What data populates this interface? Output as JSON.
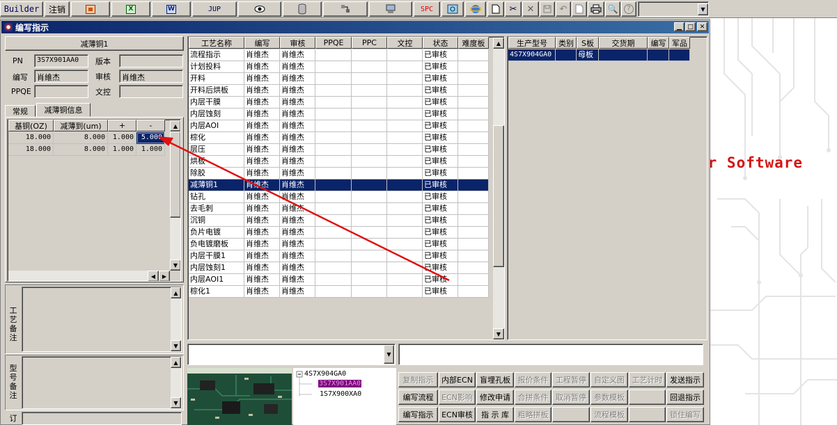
{
  "toolbar": {
    "builder_label": "Builder",
    "logout_label": "注销",
    "jup_label": "JUP",
    "spc_label": "SPC"
  },
  "window": {
    "title": "编写指示"
  },
  "left": {
    "header": "减薄铜1",
    "pn_label": "PN",
    "pn_value": "3S7X901AA0",
    "version_label": "版本",
    "version_value": "",
    "writer_label": "编写",
    "writer_value": "肖維杰",
    "reviewer_label": "审核",
    "reviewer_value": "肖维杰",
    "ppqe_label": "PPQE",
    "ppqe_value": "",
    "doc_control_label": "文控",
    "doc_control_value": "",
    "tabs": [
      "常规",
      "减薄铜信息"
    ],
    "active_tab": 1,
    "thin_grid": {
      "headers": [
        "基铜(OZ)",
        "减薄到(um)",
        "+",
        "-"
      ],
      "rows": [
        [
          "18.000",
          "8.000",
          "1.000",
          "5.000"
        ],
        [
          "18.000",
          "8.000",
          "1.000",
          "1.000"
        ]
      ]
    },
    "process_note_label": "工艺备注",
    "model_note_label": "型号备注",
    "order_label": "订"
  },
  "process_grid": {
    "headers": [
      "工艺名称",
      "编写",
      "审核",
      "PPQE",
      "PPC",
      "文控",
      "状态",
      "难度板"
    ],
    "selected_index": 11,
    "rows": [
      [
        "流程指示",
        "肖维杰",
        "肖维杰",
        "",
        "",
        "",
        "已审核",
        ""
      ],
      [
        "计划投料",
        "肖维杰",
        "肖维杰",
        "",
        "",
        "",
        "已审核",
        ""
      ],
      [
        "开料",
        "肖维杰",
        "肖维杰",
        "",
        "",
        "",
        "已审核",
        ""
      ],
      [
        "开料后烘板",
        "肖维杰",
        "肖维杰",
        "",
        "",
        "",
        "已审核",
        ""
      ],
      [
        "内层干膜",
        "肖维杰",
        "肖维杰",
        "",
        "",
        "",
        "已审核",
        ""
      ],
      [
        "内层蚀刻",
        "肖维杰",
        "肖维杰",
        "",
        "",
        "",
        "已审核",
        ""
      ],
      [
        "内层AOI",
        "肖维杰",
        "肖维杰",
        "",
        "",
        "",
        "已审核",
        ""
      ],
      [
        "棕化",
        "肖维杰",
        "肖维杰",
        "",
        "",
        "",
        "已审核",
        ""
      ],
      [
        "层压",
        "肖维杰",
        "肖维杰",
        "",
        "",
        "",
        "已审核",
        ""
      ],
      [
        "烘板",
        "肖维杰",
        "肖维杰",
        "",
        "",
        "",
        "已审核",
        ""
      ],
      [
        "除胶",
        "肖维杰",
        "肖维杰",
        "",
        "",
        "",
        "已审核",
        ""
      ],
      [
        "减薄铜1",
        "肖维杰",
        "肖维杰",
        "",
        "",
        "",
        "已审核",
        ""
      ],
      [
        "钻孔",
        "肖维杰",
        "肖维杰",
        "",
        "",
        "",
        "已审核",
        ""
      ],
      [
        "去毛刺",
        "肖维杰",
        "肖维杰",
        "",
        "",
        "",
        "已审核",
        ""
      ],
      [
        "沉铜",
        "肖维杰",
        "肖维杰",
        "",
        "",
        "",
        "已审核",
        ""
      ],
      [
        "负片电镀",
        "肖维杰",
        "肖维杰",
        "",
        "",
        "",
        "已审核",
        ""
      ],
      [
        "负电镀磨板",
        "肖维杰",
        "肖维杰",
        "",
        "",
        "",
        "已审核",
        ""
      ],
      [
        "内层干膜1",
        "肖维杰",
        "肖维杰",
        "",
        "",
        "",
        "已审核",
        ""
      ],
      [
        "内层蚀刻1",
        "肖维杰",
        "肖维杰",
        "",
        "",
        "",
        "已审核",
        ""
      ],
      [
        "内层AOI1",
        "肖维杰",
        "肖维杰",
        "",
        "",
        "",
        "已审核",
        ""
      ],
      [
        "棕化1",
        "肖维杰",
        "肖维杰",
        "",
        "",
        "",
        "已审核",
        ""
      ]
    ]
  },
  "product_grid": {
    "headers": [
      "生产型号",
      "类别",
      "S板",
      "交货期",
      "编写",
      "军品"
    ],
    "rows": [
      [
        "4S7X904GA0",
        "",
        "母板",
        "",
        "",
        ""
      ]
    ]
  },
  "tree": {
    "root": "4S7X904GA0",
    "children": [
      "3S7X901AA0",
      "1S7X900XA0"
    ],
    "selected_child": 0
  },
  "action_buttons": [
    {
      "label": "复制指示",
      "enabled": false
    },
    {
      "label": "内部ECN",
      "enabled": true
    },
    {
      "label": "盲埋孔板",
      "enabled": true
    },
    {
      "label": "报价条件",
      "enabled": false
    },
    {
      "label": "工程暂停",
      "enabled": false
    },
    {
      "label": "自定义图",
      "enabled": false
    },
    {
      "label": "工艺计时",
      "enabled": false
    },
    {
      "label": "发送指示",
      "enabled": true
    },
    {
      "label": "编写流程",
      "enabled": true
    },
    {
      "label": "ECN影响",
      "enabled": false
    },
    {
      "label": "修改申请",
      "enabled": true
    },
    {
      "label": "合拼条件",
      "enabled": false
    },
    {
      "label": "取消暂停",
      "enabled": false
    },
    {
      "label": "参数模板",
      "enabled": false
    },
    {
      "label": "",
      "enabled": false
    },
    {
      "label": "回退指示",
      "enabled": true
    },
    {
      "label": "编写指示",
      "enabled": true
    },
    {
      "label": "ECN审核",
      "enabled": true
    },
    {
      "label": "指 示 库",
      "enabled": true
    },
    {
      "label": "粗略拼板",
      "enabled": false
    },
    {
      "label": "",
      "enabled": false
    },
    {
      "label": "流程模板",
      "enabled": false
    },
    {
      "label": "",
      "enabled": false
    },
    {
      "label": "锁住编写",
      "enabled": false
    }
  ],
  "desktop_text": "er Software",
  "colors": {
    "selection": "#0a246a",
    "annotation_arrow": "#e01010",
    "tree_highlight": "#800080",
    "desktop_text": "#d41414"
  }
}
